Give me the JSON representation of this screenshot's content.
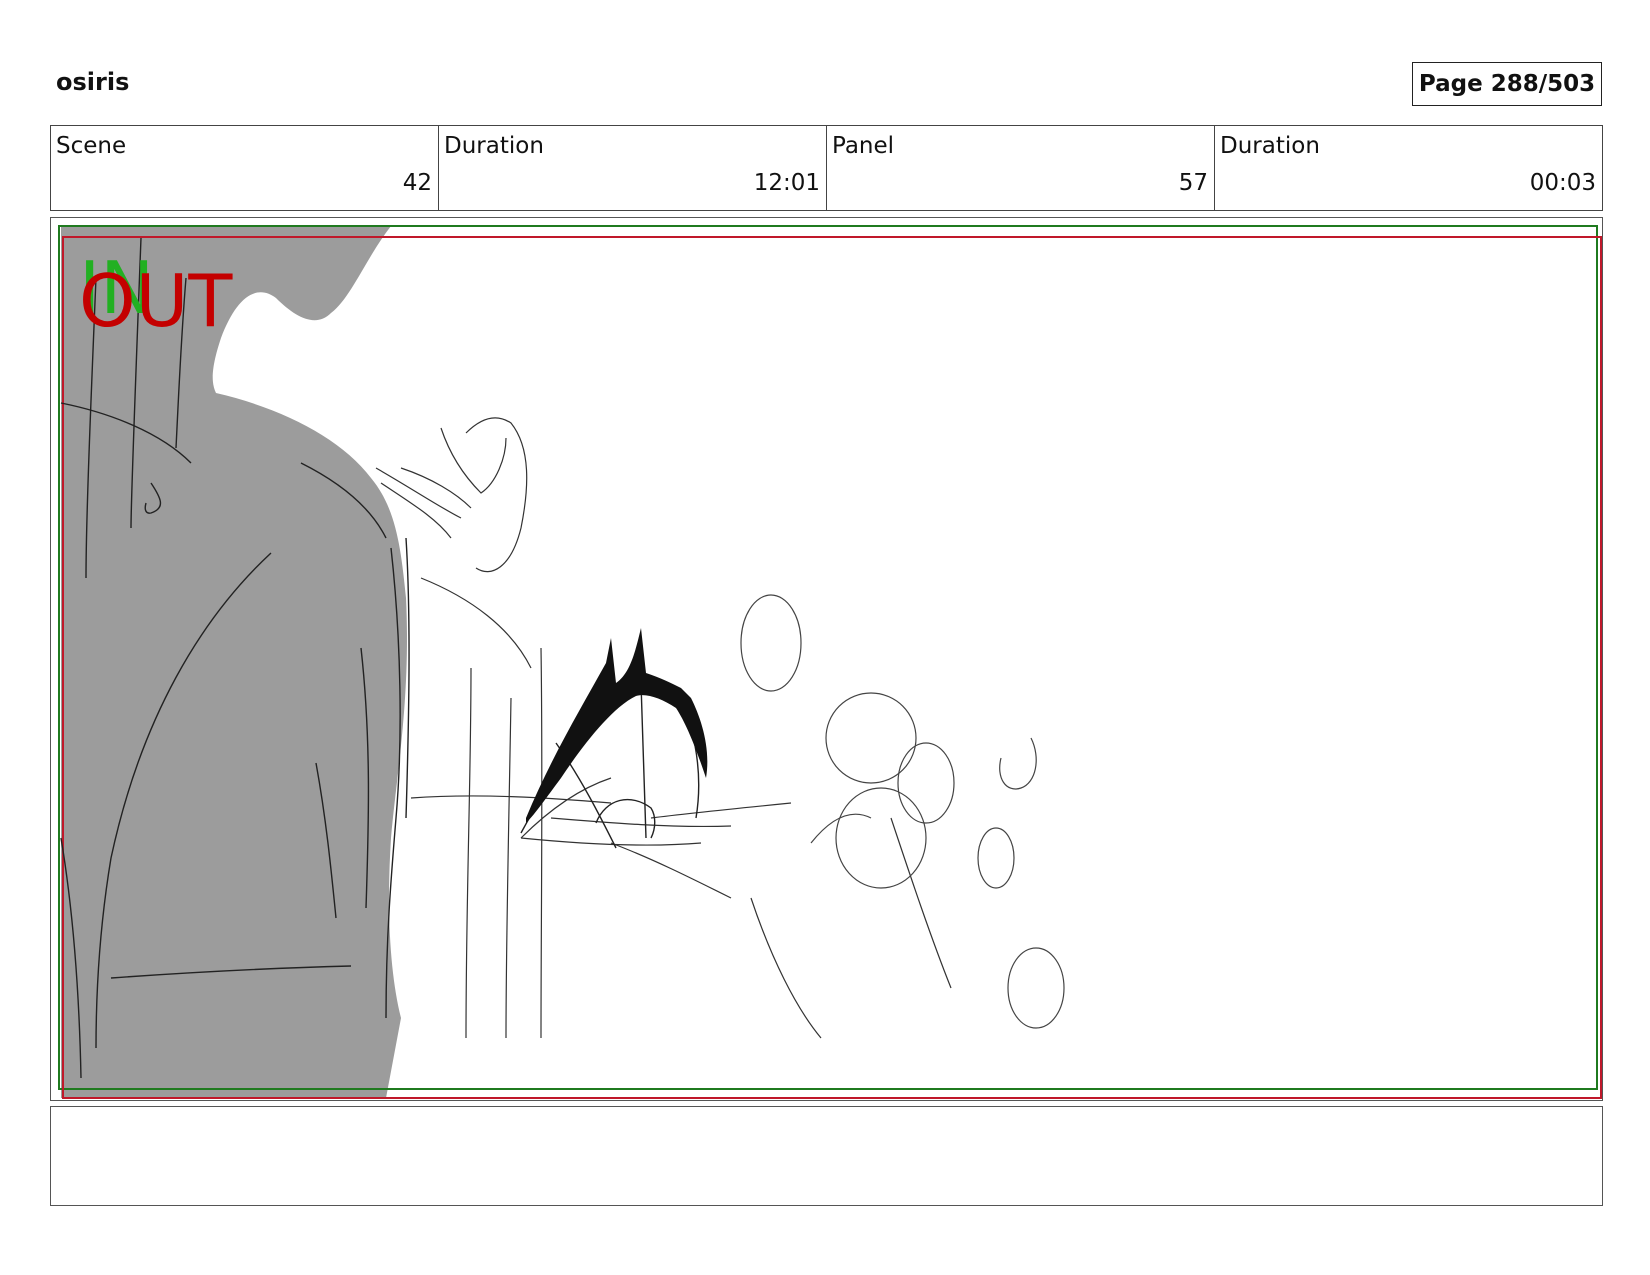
{
  "header": {
    "project_title": "osiris",
    "page_indicator": "Page 288/503"
  },
  "info": [
    {
      "label": "Scene",
      "value": "42"
    },
    {
      "label": "Duration",
      "value": "12:01"
    },
    {
      "label": "Panel",
      "value": "57"
    },
    {
      "label": "Duration",
      "value": "00:03"
    }
  ],
  "panel": {
    "in_marker": "IN",
    "out_marker": "OUT",
    "in_color": "#22b022",
    "out_color": "#c40000",
    "safe_frame_green": "#1f7a1f",
    "safe_frame_red": "#c0182a",
    "silhouette_color": "#9c9c9c"
  },
  "caption": {
    "text": ""
  }
}
